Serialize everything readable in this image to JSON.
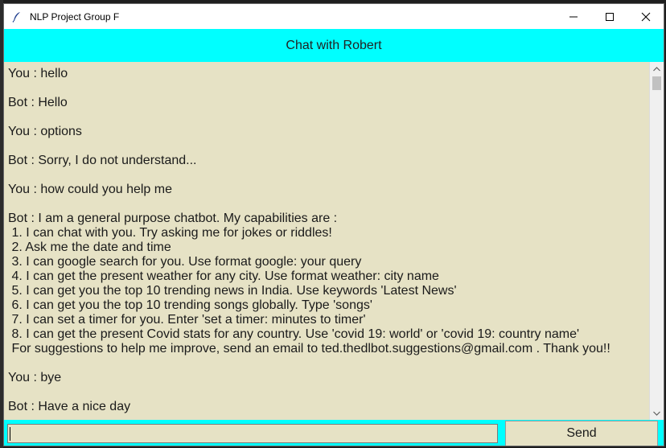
{
  "window": {
    "title": "NLP Project Group F",
    "icon": "feather-icon",
    "controls": [
      "minimize-icon",
      "maximize-icon",
      "close-icon"
    ]
  },
  "header": {
    "title": "Chat with Robert"
  },
  "chat": {
    "messages": [
      {
        "sender": "You",
        "text": "hello"
      },
      {
        "sender": "Bot",
        "text": "Hello"
      },
      {
        "sender": "You",
        "text": "options"
      },
      {
        "sender": "Bot",
        "text": "Sorry, I do not understand..."
      },
      {
        "sender": "You",
        "text": "how could you help me"
      },
      {
        "sender": "Bot",
        "text": "I am a general purpose chatbot. My capabilities are :\n 1. I can chat with you. Try asking me for jokes or riddles!\n 2. Ask me the date and time\n 3. I can google search for you. Use format google: your query\n 4. I can get the present weather for any city. Use format weather: city name\n 5. I can get you the top 10 trending news in India. Use keywords 'Latest News'\n 6. I can get you the top 10 trending songs globally. Type 'songs'\n 7. I can set a timer for you. Enter 'set a timer: minutes to timer'\n 8. I can get the present Covid stats for any country. Use 'covid 19: world' or 'covid 19: country name'\n For suggestions to help me improve, send an email to ted.thedlbot.suggestions@gmail.com . Thank you!!"
      },
      {
        "sender": "You",
        "text": "bye"
      },
      {
        "sender": "Bot",
        "text": "Have a nice day"
      }
    ]
  },
  "footer": {
    "input_value": "",
    "send_label": "Send"
  },
  "colors": {
    "accent": "#00ffff",
    "panel": "#e6e2c5"
  }
}
